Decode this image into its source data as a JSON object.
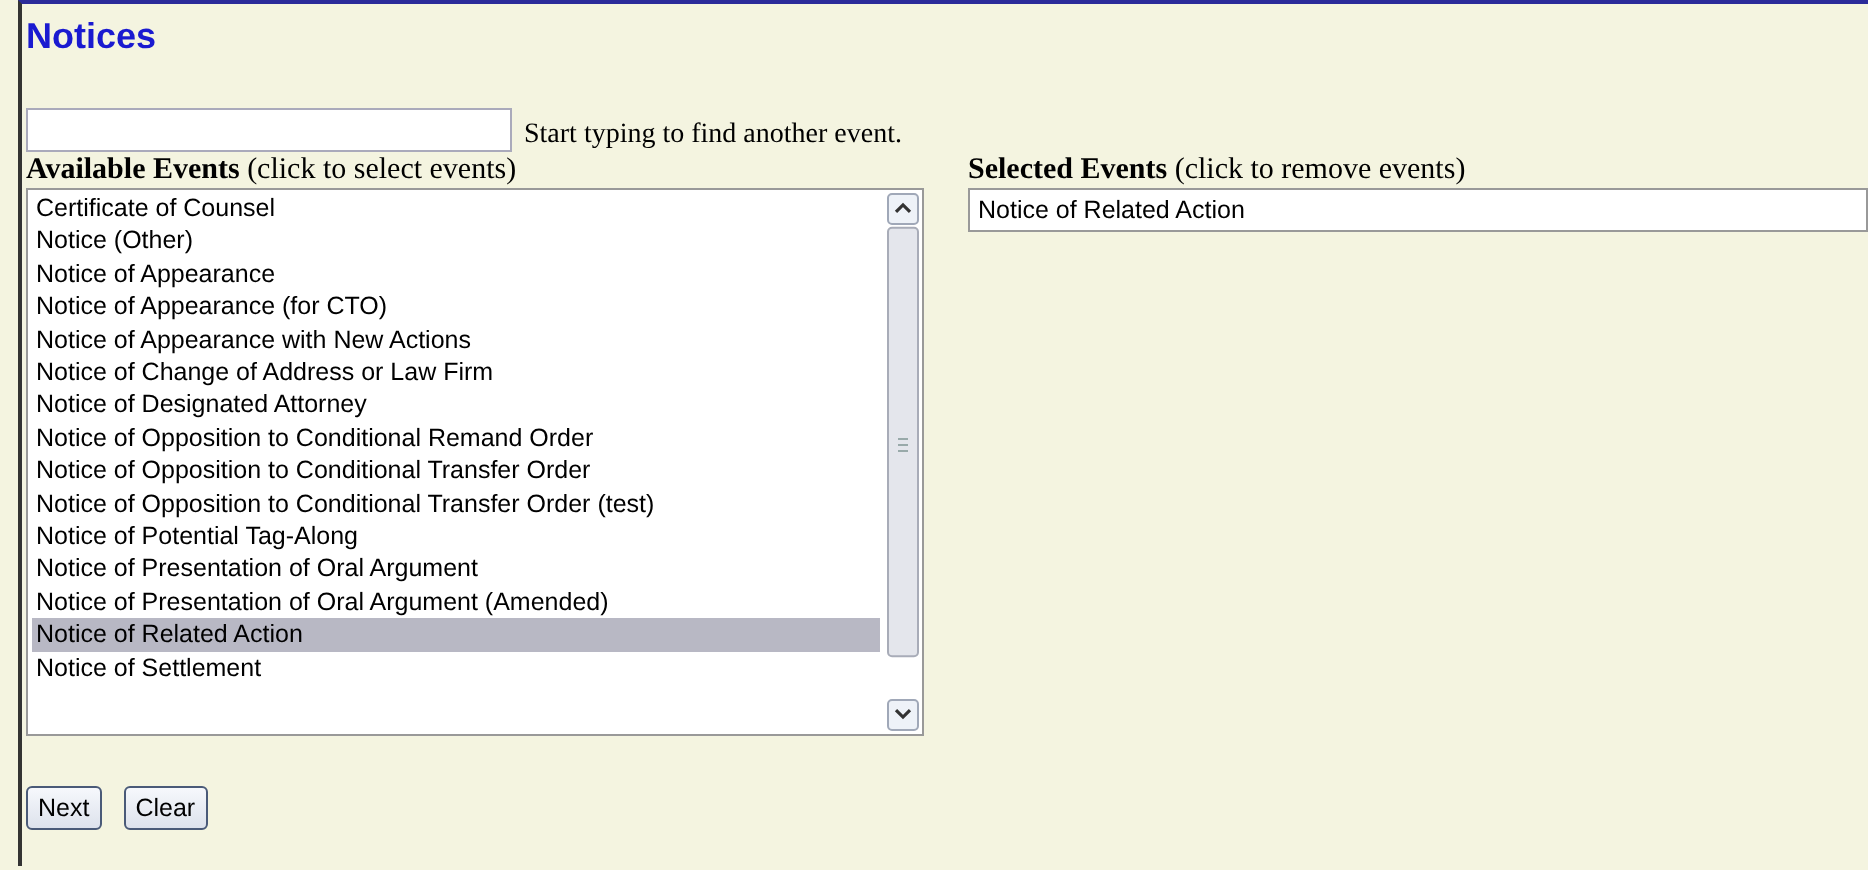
{
  "title": "Notices",
  "search": {
    "hint": "Start typing to find another event."
  },
  "available": {
    "heading": "**Available Events** (click to select events)",
    "items": [
      {
        "label": "Certificate of Counsel",
        "selected": false
      },
      {
        "label": "Notice (Other)",
        "selected": false
      },
      {
        "label": "Notice of Appearance",
        "selected": false
      },
      {
        "label": "Notice of Appearance (for CTO)",
        "selected": false
      },
      {
        "label": "Notice of Appearance with New Actions",
        "selected": false
      },
      {
        "label": "Notice of Change of Address or Law Firm",
        "selected": false
      },
      {
        "label": "Notice of Designated Attorney",
        "selected": false
      },
      {
        "label": "Notice of Opposition to Conditional Remand Order",
        "selected": false
      },
      {
        "label": "Notice of Opposition to Conditional Transfer Order",
        "selected": false
      },
      {
        "label": "Notice of Opposition to Conditional Transfer Order (test)",
        "selected": false
      },
      {
        "label": "Notice of Potential Tag-Along",
        "selected": false
      },
      {
        "label": "Notice of Presentation of Oral Argument",
        "selected": false
      },
      {
        "label": "Notice of Presentation of Oral Argument (Amended)",
        "selected": false
      },
      {
        "label": "Notice of Related Action",
        "selected": true
      },
      {
        "label": "Notice of Settlement",
        "selected": false
      }
    ]
  },
  "chosen": {
    "heading": "**Selected Events** (click to remove events)",
    "items": [
      {
        "label": "Notice of Related Action"
      }
    ]
  },
  "buttons": [
    "Next",
    "Clear"
  ]
}
